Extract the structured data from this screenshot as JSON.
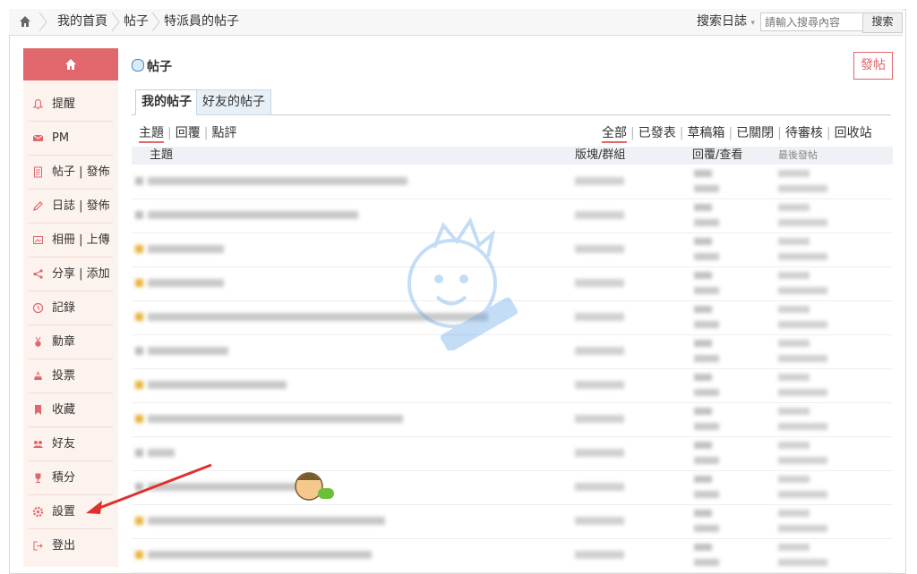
{
  "breadcrumb": {
    "items": [
      "我的首頁",
      "帖子",
      "特派員的帖子"
    ]
  },
  "search": {
    "label": "搜索日誌",
    "placeholder": "請輸入搜尋內容",
    "button": "搜索"
  },
  "sidebar": {
    "items": [
      {
        "icon": "bell-icon",
        "label": "提醒"
      },
      {
        "icon": "mail-icon",
        "label": "PM"
      },
      {
        "icon": "document-icon",
        "label": "帖子 | 發佈"
      },
      {
        "icon": "pencil-icon",
        "label": "日誌 | 發佈"
      },
      {
        "icon": "photo-icon",
        "label": "相冊 | 上傳"
      },
      {
        "icon": "share-icon",
        "label": "分享 | 添加"
      },
      {
        "icon": "clock-icon",
        "label": "記錄"
      },
      {
        "icon": "medal-icon",
        "label": "勳章"
      },
      {
        "icon": "vote-icon",
        "label": "投票"
      },
      {
        "icon": "bookmark-icon",
        "label": "收藏"
      },
      {
        "icon": "friends-icon",
        "label": "好友"
      },
      {
        "icon": "trophy-icon",
        "label": "積分"
      },
      {
        "icon": "gear-icon",
        "label": "設置"
      },
      {
        "icon": "logout-icon",
        "label": "登出"
      }
    ]
  },
  "main": {
    "title": "帖子",
    "post_button": "發帖",
    "tabs": [
      {
        "label": "我的帖子",
        "active": true
      },
      {
        "label": "好友的帖子",
        "active": false
      }
    ],
    "subnav_left": [
      "主題",
      "回覆",
      "點評"
    ],
    "subnav_right": [
      "全部",
      "已發表",
      "草稿箱",
      "已關閉",
      "待審核",
      "回收站"
    ],
    "columns": {
      "topic": "主題",
      "forum": "版塊/群組",
      "replies": "回覆/查看",
      "last": "最後發帖"
    }
  },
  "colors": {
    "accent": "#e0676b",
    "sidebar_bg": "#fdf3ee"
  }
}
